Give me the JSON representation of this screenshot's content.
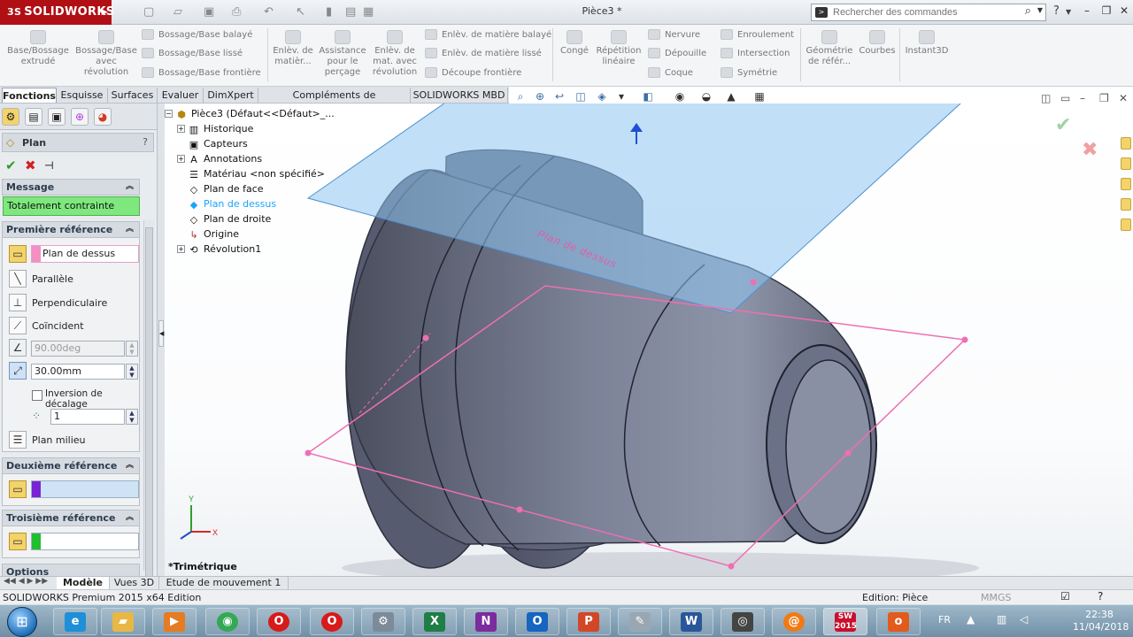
{
  "app": {
    "brand": "SOLIDWORKS",
    "doc_title": "Pièce3 *",
    "search_placeholder": "Rechercher des commandes"
  },
  "ribbon": {
    "buttons": [
      {
        "id": "base-extrude",
        "label": "Base/Bossage extrudé"
      },
      {
        "id": "base-revolve",
        "label": "Bossage/Base avec révolution"
      },
      {
        "id": "cut-extrude",
        "label": "Enlèv. de matièr..."
      },
      {
        "id": "hole-wizard",
        "label": "Assistance pour le perçage"
      },
      {
        "id": "cut-revolve",
        "label": "Enlèv. de mat. avec révolution"
      },
      {
        "id": "fillet",
        "label": "Congé"
      },
      {
        "id": "linear-pattern",
        "label": "Répétition linéaire"
      },
      {
        "id": "ref-geometry",
        "label": "Géométrie de référ..."
      },
      {
        "id": "curves",
        "label": "Courbes"
      },
      {
        "id": "instant3d",
        "label": "Instant3D"
      }
    ],
    "small": [
      {
        "id": "swept-boss",
        "label": "Bossage/Base balayé"
      },
      {
        "id": "lofted-boss",
        "label": "Bossage/Base lissé"
      },
      {
        "id": "boundary-boss",
        "label": "Bossage/Base frontière"
      },
      {
        "id": "swept-cut",
        "label": "Enlèv. de matière balayé"
      },
      {
        "id": "lofted-cut",
        "label": "Enlèv. de matière lissé"
      },
      {
        "id": "boundary-cut",
        "label": "Découpe frontière"
      },
      {
        "id": "rib",
        "label": "Nervure"
      },
      {
        "id": "draft",
        "label": "Dépouille"
      },
      {
        "id": "shell",
        "label": "Coque"
      },
      {
        "id": "wrap",
        "label": "Enroulement"
      },
      {
        "id": "intersect",
        "label": "Intersection"
      },
      {
        "id": "mirror",
        "label": "Symétrie"
      }
    ]
  },
  "tabs": [
    "Fonctions",
    "Esquisse",
    "Surfaces",
    "Evaluer",
    "DimXpert",
    "Compléments de SOLIDWORKS",
    "SOLIDWORKS MBD"
  ],
  "pm": {
    "title": "Plan",
    "help": "?",
    "message_header": "Message",
    "message": "Totalement contrainte",
    "first_ref": {
      "header": "Première référence",
      "value": "Plan de dessus",
      "options": [
        "Parallèle",
        "Perpendiculaire",
        "Coïncident"
      ],
      "angle": "90.00deg",
      "offset": "30.00mm",
      "flip_label": "Inversion de décalage",
      "count": "1",
      "mid_plane": "Plan milieu"
    },
    "second_ref": {
      "header": "Deuxième référence",
      "value": ""
    },
    "third_ref": {
      "header": "Troisième référence",
      "value": ""
    },
    "options_header": "Options"
  },
  "tree": {
    "root": "Pièce3  (Défaut<<Défaut>_...",
    "items": [
      {
        "label": "Historique",
        "expand": true
      },
      {
        "label": "Capteurs",
        "expand": false
      },
      {
        "label": "Annotations",
        "expand": true
      },
      {
        "label": "Matériau <non spécifié>",
        "expand": false
      },
      {
        "label": "Plan de face",
        "expand": false
      },
      {
        "label": "Plan de dessus",
        "expand": false,
        "selected": true
      },
      {
        "label": "Plan de droite",
        "expand": false
      },
      {
        "label": "Origine",
        "expand": false
      },
      {
        "label": "Révolution1",
        "expand": true
      }
    ]
  },
  "viewport": {
    "plane_label": "Plan de dessus",
    "view_name": "*Trimétrique",
    "triad_x": "X",
    "triad_y": "Y"
  },
  "bottom_tabs": [
    "Modèle",
    "Vues 3D",
    "Etude de mouvement 1"
  ],
  "status": {
    "left": "SOLIDWORKS Premium 2015 x64 Edition",
    "mode": "Edition: Pièce",
    "units": "MMGS"
  },
  "taskbar": {
    "lang": "FR",
    "time": "22:38",
    "date": "11/04/2018",
    "sw_badge": "2015"
  },
  "colors": {
    "accent_red": "#b00f14",
    "plane_blue": "#8ec5f0",
    "plane_pink": "#ee6fb3",
    "message_green": "#7ee87e",
    "selected_tree": "#1aa3ff"
  }
}
